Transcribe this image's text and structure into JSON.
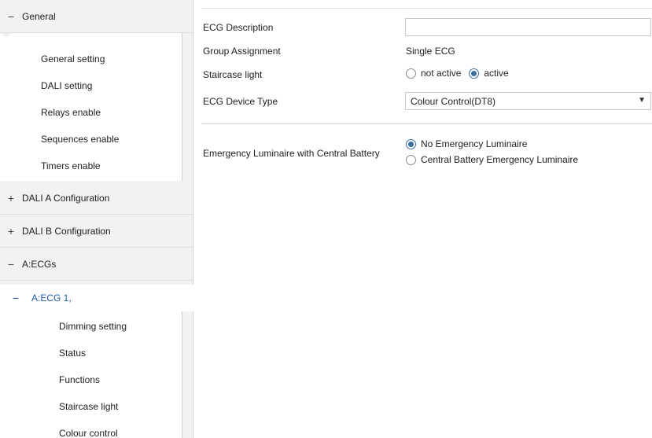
{
  "sidebar": {
    "general": {
      "sign": "−",
      "label": "General"
    },
    "general_items": [
      "General setting",
      "DALI setting",
      "Relays enable",
      "Sequences enable",
      "Timers enable"
    ],
    "dali_a": {
      "sign": "+",
      "label": "DALI A Configuration"
    },
    "dali_b": {
      "sign": "+",
      "label": "DALI B Configuration"
    },
    "a_ecgs": {
      "sign": "−",
      "label": "A:ECGs"
    },
    "a_ecg1": {
      "sign": "−",
      "label": "A:ECG 1,"
    },
    "ecg1_items": [
      "Dimming setting",
      "Status",
      "Functions",
      "Staircase light",
      "Colour control"
    ]
  },
  "form": {
    "ecg_description": {
      "label": "ECG Description",
      "value": ""
    },
    "group_assignment": {
      "label": "Group Assignment",
      "value": "Single ECG"
    },
    "staircase_light": {
      "label": "Staircase light",
      "opt1": "not active",
      "opt2": "active",
      "selected": "active"
    },
    "ecg_device_type": {
      "label": "ECG Device Type",
      "value": "Colour Control(DT8)"
    },
    "emergency": {
      "label": "Emergency Luminaire with Central Battery",
      "opt1": "No Emergency Luminaire",
      "opt2": "Central Battery Emergency Luminaire",
      "selected": "No Emergency Luminaire"
    }
  },
  "colors": {
    "accent": "#1f5aa6",
    "sidebar_bg": "#f2f2f2"
  }
}
